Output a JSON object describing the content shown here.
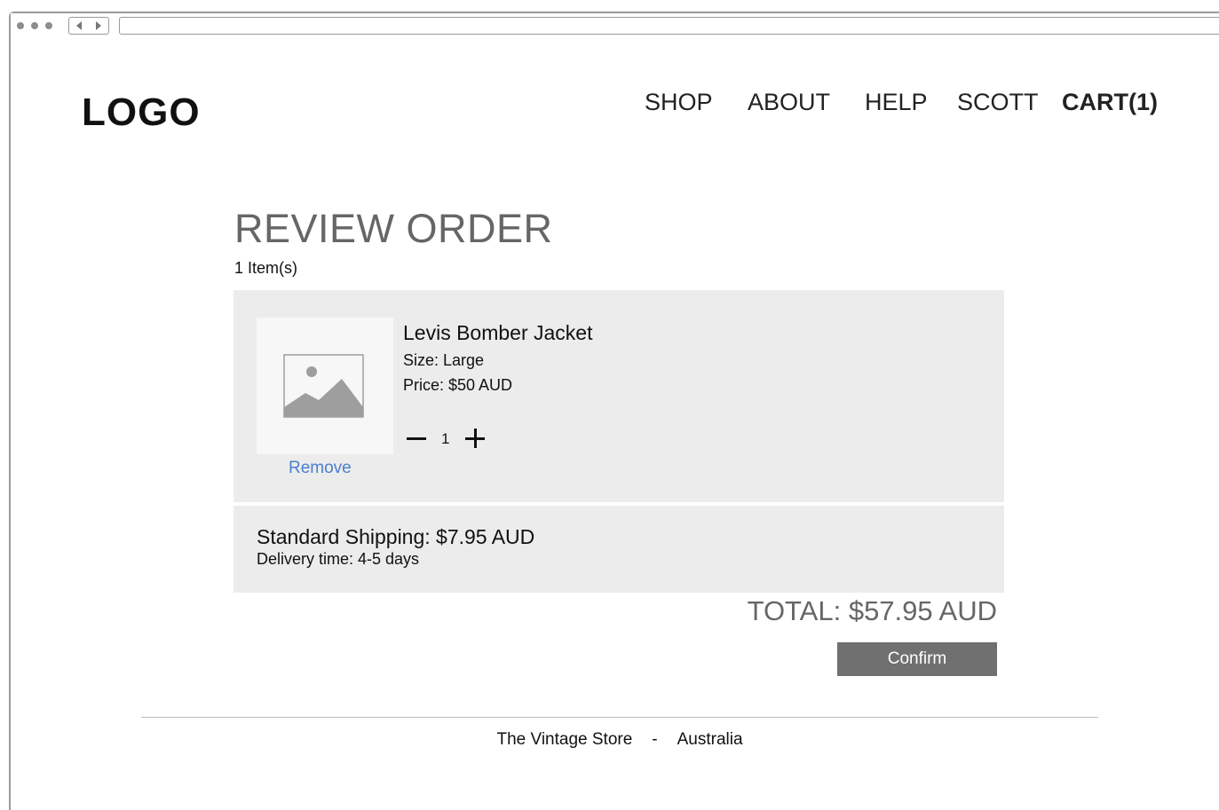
{
  "header": {
    "logo": "LOGO",
    "nav": [
      {
        "label": "SHOP"
      },
      {
        "label": "ABOUT"
      },
      {
        "label": "HELP"
      },
      {
        "label": "SCOTT"
      },
      {
        "label": "CART(1)"
      }
    ]
  },
  "order": {
    "title": "REVIEW ORDER",
    "item_count": "1 Item(s)",
    "items": [
      {
        "name": "Levis Bomber Jacket",
        "size": "Size: Large",
        "price": "Price: $50 AUD",
        "quantity": "1",
        "remove_label": "Remove",
        "image_icon": "image-placeholder-icon"
      }
    ],
    "shipping": {
      "title": "Standard Shipping: $7.95 AUD",
      "delivery": "Delivery time: 4-5 days"
    },
    "total": "TOTAL: $57.95 AUD",
    "confirm_label": "Confirm"
  },
  "footer": {
    "store": "The Vintage Store",
    "separator": "-",
    "country": "Australia"
  },
  "colors": {
    "card_bg": "#ececec",
    "link": "#4a7fcf",
    "button_bg": "#707070",
    "muted_text": "#666666"
  }
}
